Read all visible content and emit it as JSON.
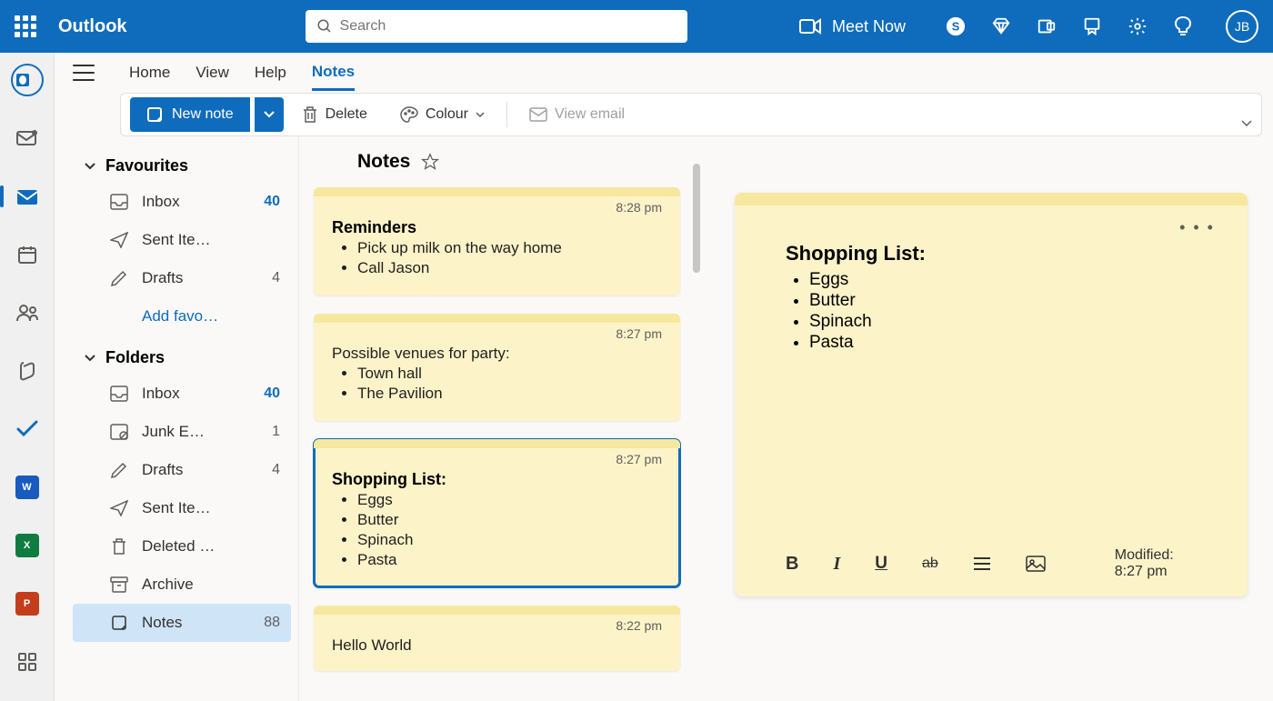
{
  "header": {
    "brand": "Outlook",
    "search_placeholder": "Search",
    "meet_now": "Meet Now",
    "avatar_initials": "JB"
  },
  "tabs": {
    "home": "Home",
    "view": "View",
    "help": "Help",
    "notes": "Notes"
  },
  "toolbar": {
    "new_note": "New note",
    "delete": "Delete",
    "colour": "Colour",
    "view_email": "View email"
  },
  "folders": {
    "favourites_header": "Favourites",
    "folders_header": "Folders",
    "inbox": "Inbox",
    "inbox_count": "40",
    "sent": "Sent Ite…",
    "drafts": "Drafts",
    "drafts_count": "4",
    "add_fav": "Add favo…",
    "junk": "Junk E…",
    "junk_count": "1",
    "deleted": "Deleted …",
    "archive": "Archive",
    "notes": "Notes",
    "notes_count": "88"
  },
  "notes_panel": {
    "title": "Notes"
  },
  "notes": [
    {
      "time": "8:28 pm",
      "title": "Reminders",
      "items": [
        "Pick up milk on the way home",
        "Call Jason"
      ]
    },
    {
      "time": "8:27 pm",
      "title_plain": "Possible venues for party:",
      "items": [
        "Town hall",
        "The Pavilion"
      ]
    },
    {
      "time": "8:27 pm",
      "title": "Shopping List:",
      "items": [
        "Eggs",
        "Butter",
        "Spinach",
        "Pasta"
      ],
      "selected": true
    },
    {
      "time": "8:22 pm",
      "title_plain": "Hello World"
    }
  ],
  "editor": {
    "title": "Shopping List:",
    "items": [
      "Eggs",
      "Butter",
      "Spinach",
      "Pasta"
    ],
    "modified": "Modified: 8:27 pm"
  }
}
